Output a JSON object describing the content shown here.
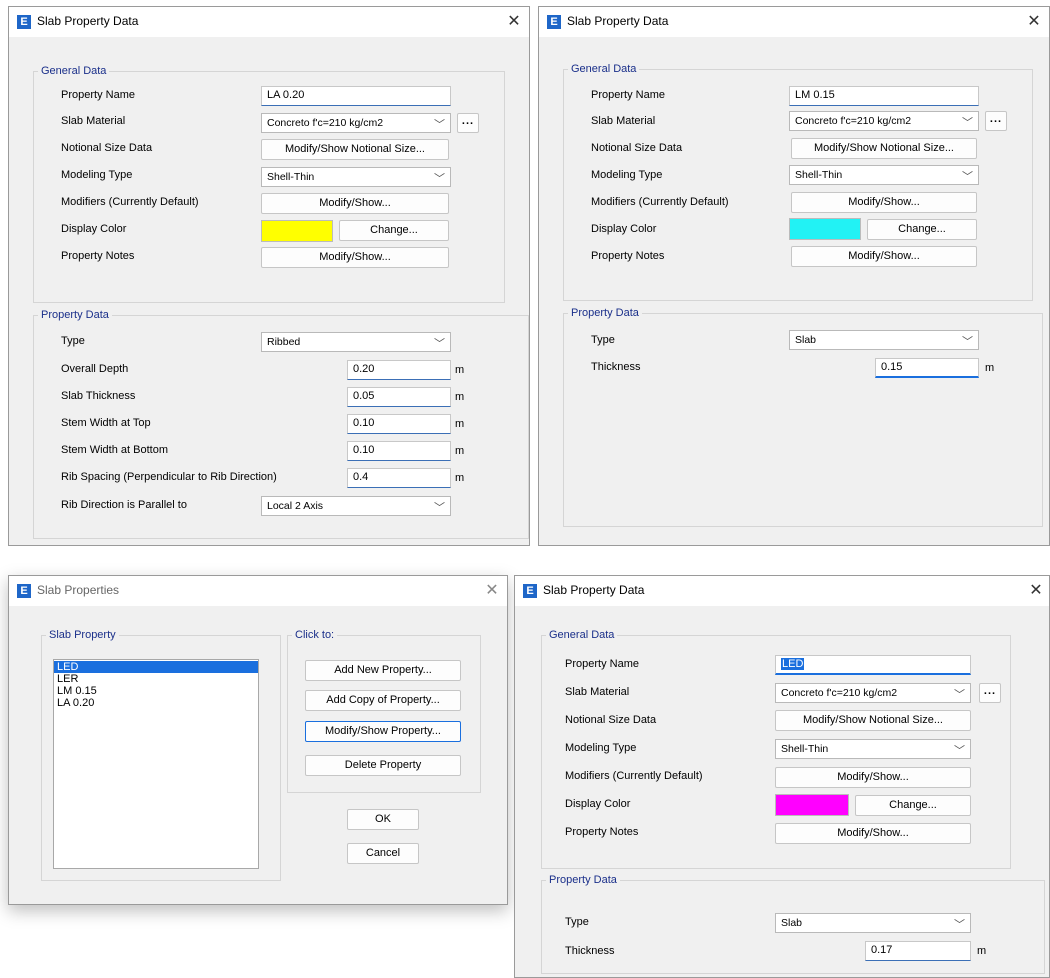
{
  "app_icon": "E",
  "dialog_a": {
    "title": "Slab Property Data",
    "general_group": "General Data",
    "property_name_label": "Property Name",
    "property_name_value": "LA 0.20",
    "slab_material_label": "Slab Material",
    "slab_material_value": "Concreto f'c=210 kg/cm2",
    "material_more": "...",
    "notional_label": "Notional Size Data",
    "notional_button": "Modify/Show Notional Size...",
    "modeling_type_label": "Modeling Type",
    "modeling_type_value": "Shell-Thin",
    "modifiers_label": "Modifiers (Currently Default)",
    "modifiers_button": "Modify/Show...",
    "display_color_label": "Display Color",
    "display_color": "#ffff00",
    "change_button": "Change...",
    "notes_label": "Property Notes",
    "notes_button": "Modify/Show...",
    "property_group": "Property Data",
    "type_label": "Type",
    "type_value": "Ribbed",
    "overall_depth_label": "Overall Depth",
    "overall_depth_value": "0.20",
    "slab_thickness_label": "Slab Thickness",
    "slab_thickness_value": "0.05",
    "stem_top_label": "Stem Width at Top",
    "stem_top_value": "0.10",
    "stem_bottom_label": "Stem Width at Bottom",
    "stem_bottom_value": "0.10",
    "rib_spacing_label": "Rib Spacing (Perpendicular to Rib Direction)",
    "rib_spacing_value": "0.4",
    "rib_direction_label": "Rib Direction is Parallel to",
    "rib_direction_value": "Local 2 Axis",
    "unit": "m"
  },
  "dialog_b": {
    "title": "Slab Property Data",
    "general_group": "General Data",
    "property_name_label": "Property Name",
    "property_name_value": "LM 0.15",
    "slab_material_label": "Slab Material",
    "slab_material_value": "Concreto f'c=210 kg/cm2",
    "material_more": "...",
    "notional_label": "Notional Size Data",
    "notional_button": "Modify/Show Notional Size...",
    "modeling_type_label": "Modeling Type",
    "modeling_type_value": "Shell-Thin",
    "modifiers_label": "Modifiers (Currently Default)",
    "modifiers_button": "Modify/Show...",
    "display_color_label": "Display Color",
    "display_color": "#22f2f4",
    "change_button": "Change...",
    "notes_label": "Property Notes",
    "notes_button": "Modify/Show...",
    "property_group": "Property Data",
    "type_label": "Type",
    "type_value": "Slab",
    "thickness_label": "Thickness",
    "thickness_value": "0.15",
    "unit": "m"
  },
  "dialog_c": {
    "title": "Slab Properties",
    "list_group": "Slab Property",
    "items": [
      "LED",
      "LER",
      "LM 0.15",
      "LA 0.20"
    ],
    "selected_index": 0,
    "click_group": "Click to:",
    "add_new_button": "Add New Property...",
    "add_copy_button": "Add Copy of Property...",
    "modify_button": "Modify/Show Property...",
    "delete_button": "Delete Property",
    "ok_button": "OK",
    "cancel_button": "Cancel"
  },
  "dialog_d": {
    "title": "Slab Property Data",
    "general_group": "General Data",
    "property_name_label": "Property Name",
    "property_name_value": "LED",
    "slab_material_label": "Slab Material",
    "slab_material_value": "Concreto f'c=210 kg/cm2",
    "material_more": "...",
    "notional_label": "Notional Size Data",
    "notional_button": "Modify/Show Notional Size...",
    "modeling_type_label": "Modeling Type",
    "modeling_type_value": "Shell-Thin",
    "modifiers_label": "Modifiers (Currently Default)",
    "modifiers_button": "Modify/Show...",
    "display_color_label": "Display Color",
    "display_color": "#ff00ff",
    "change_button": "Change...",
    "notes_label": "Property Notes",
    "notes_button": "Modify/Show...",
    "property_group": "Property Data",
    "type_label": "Type",
    "type_value": "Slab",
    "thickness_label": "Thickness",
    "thickness_value": "0.17",
    "unit": "m"
  }
}
